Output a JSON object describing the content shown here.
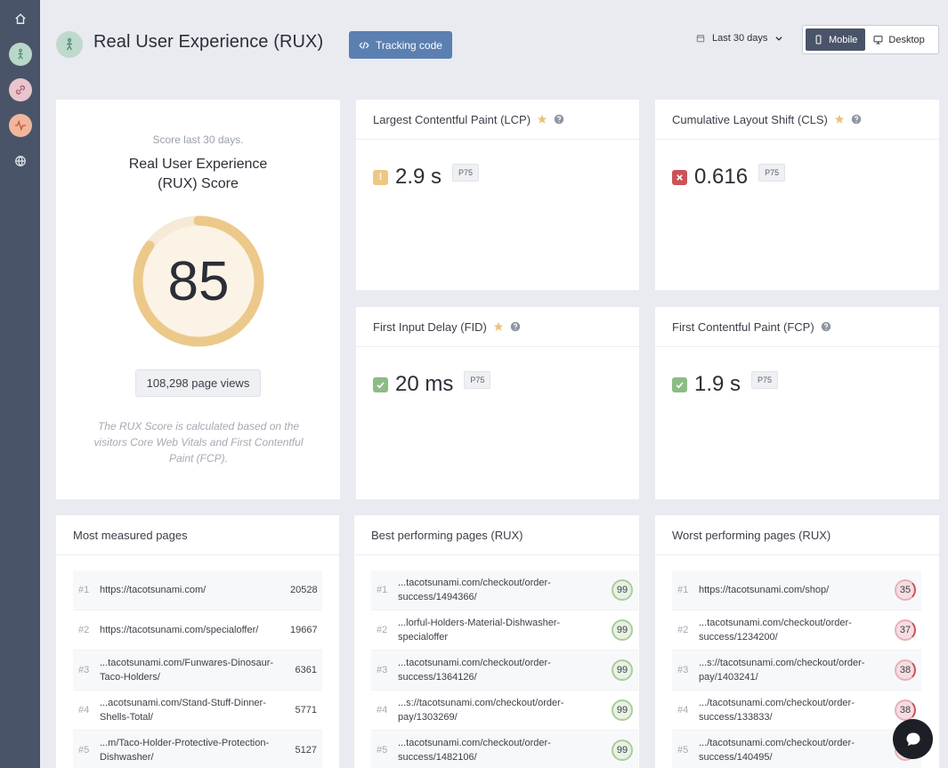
{
  "header": {
    "title": "Real User Experience (RUX)",
    "tracking_label": "Tracking code",
    "period_label": "Last 30 days",
    "mobile_label": "Mobile",
    "desktop_label": "Desktop"
  },
  "score": {
    "subtitle": "Score last 30 days.",
    "title": "Real User Experience (RUX) Score",
    "value": "85",
    "percent": 85,
    "page_views": "108,298 page views",
    "note": "The RUX Score is calculated based on the visitors Core Web Vitals and First Contentful Paint (FCP).",
    "ring_color": "#ecc98a",
    "ring_bg": "#f9efe0"
  },
  "metrics": {
    "lcp": {
      "title": "Largest Contentful Paint (LCP)",
      "value": "2.9 s",
      "badge": "P75",
      "status": "warning",
      "status_glyph": "!"
    },
    "cls": {
      "title": "Cumulative Layout Shift (CLS)",
      "value": "0.616",
      "badge": "P75",
      "status": "poor"
    },
    "fid": {
      "title": "First Input Delay (FID)",
      "value": "20 ms",
      "badge": "P75",
      "status": "good"
    },
    "fcp": {
      "title": "First Contentful Paint (FCP)",
      "value": "1.9 s",
      "badge": "P75",
      "status": "good"
    }
  },
  "most_measured": {
    "title": "Most measured pages",
    "rows": [
      {
        "rank": "#1",
        "url": "https://tacotsunami.com/",
        "count": "20528"
      },
      {
        "rank": "#2",
        "url": "https://tacotsunami.com/specialoffer/",
        "count": "19667"
      },
      {
        "rank": "#3",
        "url": "...tacotsunami.com/Funwares-Dinosaur-Taco-Holders/",
        "count": "6361"
      },
      {
        "rank": "#4",
        "url": "...acotsunami.com/Stand-Stuff-Dinner-Shells-Total/",
        "count": "5771"
      },
      {
        "rank": "#5",
        "url": "...m/Taco-Holder-Protective-Protection-Dishwasher/",
        "count": "5127"
      }
    ]
  },
  "best": {
    "title": "Best performing pages (RUX)",
    "rows": [
      {
        "rank": "#1",
        "url": "...tacotsunami.com/checkout/order-success/1494366/",
        "score": "99"
      },
      {
        "rank": "#2",
        "url": "...lorful-Holders-Material-Dishwasher-specialoffer",
        "score": "99"
      },
      {
        "rank": "#3",
        "url": "...tacotsunami.com/checkout/order-success/1364126/",
        "score": "99"
      },
      {
        "rank": "#4",
        "url": "...s://tacotsunami.com/checkout/order-pay/1303269/",
        "score": "99"
      },
      {
        "rank": "#5",
        "url": "...tacotsunami.com/checkout/order-success/1482106/",
        "score": "99"
      }
    ]
  },
  "worst": {
    "title": "Worst performing pages (RUX)",
    "rows": [
      {
        "rank": "#1",
        "url": "https://tacotsunami.com/shop/",
        "score": "35"
      },
      {
        "rank": "#2",
        "url": "...tacotsunami.com/checkout/order-success/1234200/",
        "score": "37"
      },
      {
        "rank": "#3",
        "url": "...s://tacotsunami.com/checkout/order-pay/1403241/",
        "score": "38"
      },
      {
        "rank": "#4",
        "url": ".../tacotsunami.com/checkout/order-success/133833/",
        "score": "38"
      },
      {
        "rank": "#5",
        "url": ".../tacotsunami.com/checkout/order-success/140495/",
        "score": ""
      }
    ]
  }
}
